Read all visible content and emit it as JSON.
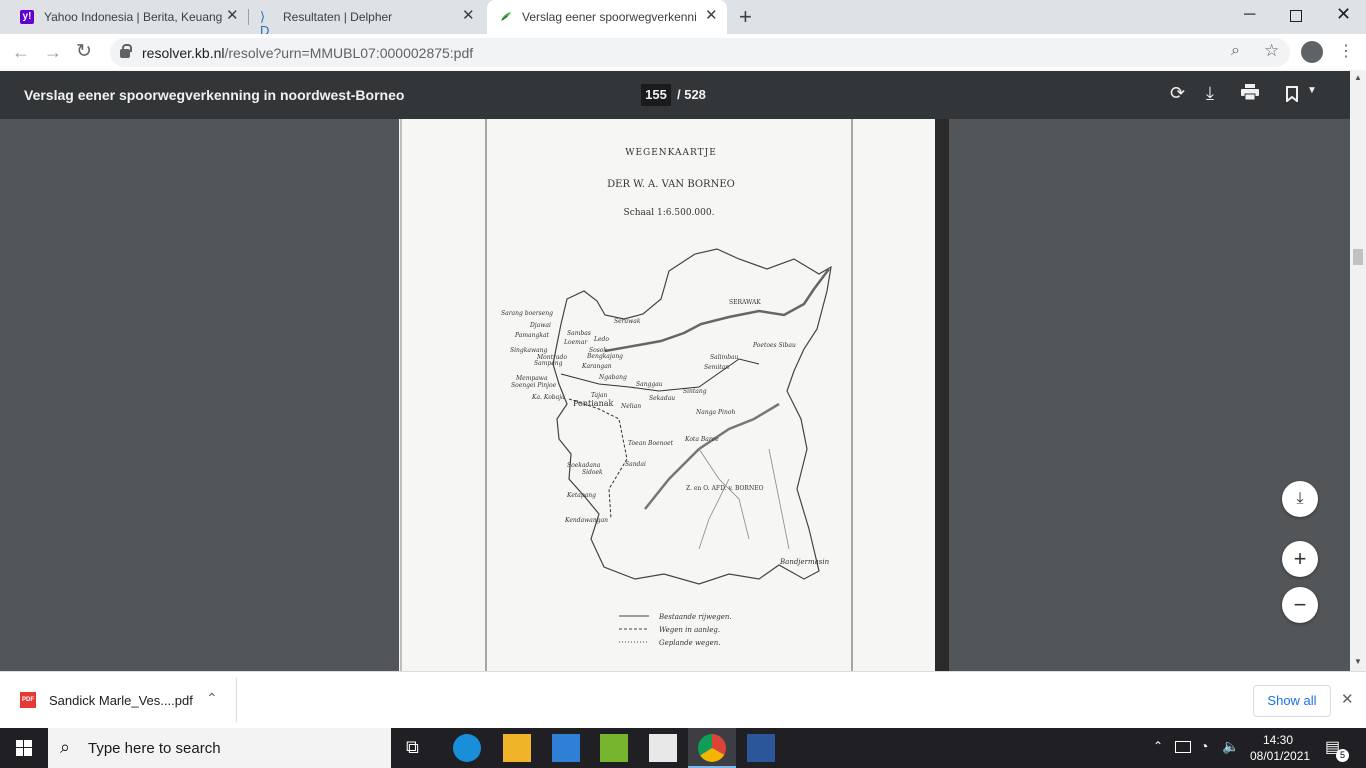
{
  "browser": {
    "tabs": [
      {
        "title": "Yahoo Indonesia | Berita, Keuang",
        "icon": "yahoo-icon",
        "active": false
      },
      {
        "title": "Resultaten | Delpher",
        "icon": "delpher-icon",
        "active": false
      },
      {
        "title": "Verslag eener spoorwegverkenni",
        "icon": "kb-icon",
        "active": true
      }
    ],
    "new_tab": "+",
    "url": {
      "host": "resolver.kb.nl",
      "rest": "/resolve?urn=MMUBL07:000002875:pdf"
    }
  },
  "pdf": {
    "title": "Verslag eener spoorwegverkenning in noordwest-Borneo",
    "current_page": "155",
    "total_pages": "/ 528"
  },
  "map": {
    "heading": "WEGENKAARTJE",
    "subtitle": "DER W. A. VAN BORNEO",
    "scale": "Schaal 1:6.500.000.",
    "regions": [
      "SERAWAK",
      "Z. en O. AFD. v. BORNEO"
    ],
    "places": [
      "Serawak",
      "Sarang boerseng",
      "Djawai",
      "Pamangkat",
      "Sambas",
      "Ledo",
      "Loemar",
      "Singkawang",
      "Bengkajang",
      "Montrado",
      "Sampang",
      "Karangan",
      "Sosok",
      "Ngabang",
      "Mempawa",
      "Soengei Pinjoe",
      "Sanggau",
      "Sintang",
      "Salimbau",
      "Semitan",
      "Poetoes Sibau",
      "Ka. Kobaja",
      "Tajan",
      "Sekadau",
      "Pontianak",
      "Nelian",
      "Nanga Pinoh",
      "Kota Baroe",
      "Toean Boenoet",
      "Soekadana",
      "Sidoek",
      "Sandai",
      "Ketapang",
      "Kendawangan",
      "Bandjermasin"
    ],
    "legend": [
      "Bestaande rijwegen.",
      "Wegen in aanleg.",
      "Geplande wegen."
    ]
  },
  "zoom": {
    "fit": "⤓",
    "plus": "+",
    "minus": "−"
  },
  "downloads": {
    "file": "Sandick Marle_Ves....pdf",
    "show_all": "Show all"
  },
  "taskbar": {
    "search_placeholder": "Type here to search",
    "time": "14:30",
    "date": "08/01/2021",
    "notifications": "5"
  }
}
